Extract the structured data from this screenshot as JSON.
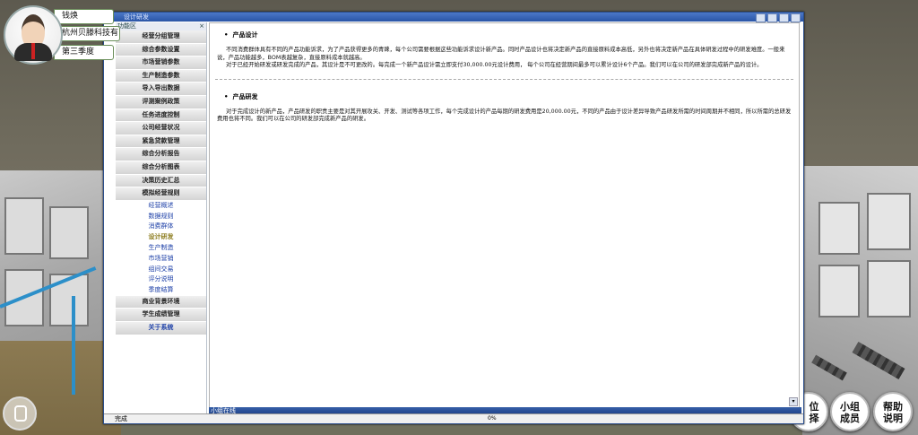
{
  "user": {
    "name": "钱焕",
    "company": "杭州贝滕科技有",
    "period": "第三季度"
  },
  "window": {
    "title": "设计研发",
    "sidebar_title": "功能区"
  },
  "sidebar": {
    "items_top": [
      "经营分组管理",
      "综合参数设置",
      "市场营销参数",
      "生产制造参数",
      "导入导出数据",
      "评测案例政策",
      "任务进度控制",
      "公司经营状况",
      "紧急贷款管理",
      "综合分析报告",
      "综合分析图表",
      "决策历史汇总",
      "模拟经营规则"
    ],
    "sub_items": [
      "经营概述",
      "数据规则",
      "消费群体",
      "设计研发",
      "生产制造",
      "市场营销",
      "组间交易",
      "评分说明",
      "季度结算"
    ],
    "active_sub": "设计研发",
    "items_bottom": [
      "商业背景环境",
      "学生成绩管理",
      "关于系统"
    ]
  },
  "content": {
    "sec1_title": "产品设计",
    "sec1_p1": "不同消费群体具有不同的产品功能诉求，为了产品获得更多的青睐，每个公司需要根据这些功能诉求设计新产品。同时产品设计也将决定新产品的直接原料成本高低，另外也将决定新产品在具体研发过程中的研发难度。一般来说，产品功能越多，BOM表越复杂，直接原料成本就越高。",
    "sec1_p2": "对于已经开始研发或研发完成的产品，其设计是不可更改的。每完成一个新产品设计需立即支付30,000.00元设计费用，  每个公司在经营期间最多可以累计设计6个产品。我们可以在公司的研发部完成新产品的设计。",
    "sec2_title": "产品研发",
    "sec2_p1": "对于完成设计的新产品，产品研发的职责主要是对其开展攻关、开发、测试等各项工作，每个完成设计的产品每期的研发费用是20,000.00元，不同的产品由于设计差异导致产品研发所需的时间周期并不相同，所以所需的总研发费用也将不同。我们可以在公司的研发部完成新产品的研发。"
  },
  "chatbar": "小组在线",
  "status": {
    "left": "完成",
    "progress": "0%"
  },
  "buttons": {
    "position_partial": "位\n择",
    "group_members": "小组\n成员",
    "help": "帮助\n说明"
  }
}
